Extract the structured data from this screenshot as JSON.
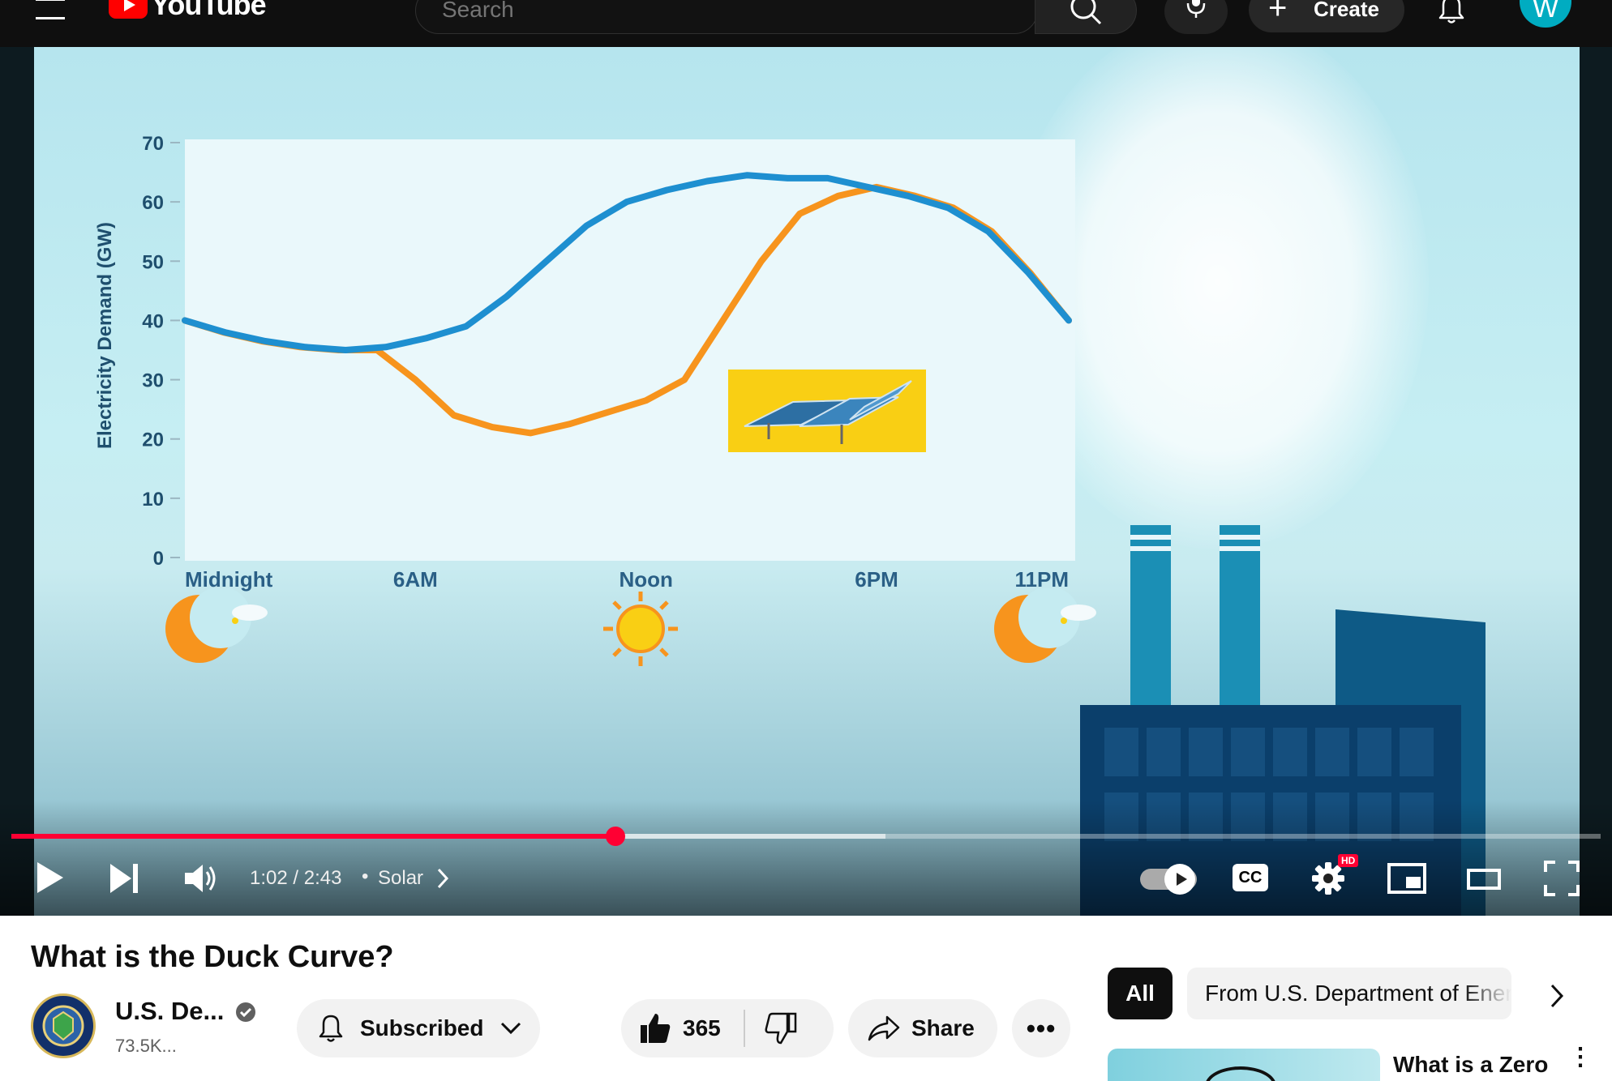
{
  "header": {
    "logo_text": "YouTube",
    "search_placeholder": "Search",
    "create_label": "Create",
    "avatar_letter": "W",
    "brand_color": "#ff0000",
    "avatar_color": "#00acc1"
  },
  "video": {
    "chart_data": {
      "type": "line",
      "ylabel": "Electricity Demand (GW)",
      "yticks": [
        "70",
        "60",
        "50",
        "40",
        "30",
        "20",
        "10",
        "0"
      ],
      "ylim": [
        0,
        70
      ],
      "xticks": [
        "Midnight",
        "6AM",
        "Noon",
        "6PM",
        "11PM"
      ],
      "x": [
        0,
        1,
        2,
        3,
        4,
        5,
        6,
        7,
        8,
        9,
        10,
        11,
        12,
        13,
        14,
        15,
        16,
        17,
        18,
        19,
        20,
        21,
        22,
        23
      ],
      "series": [
        {
          "color": "#1e8fd0",
          "values": [
            40,
            38,
            36.5,
            35.5,
            35,
            35.5,
            37,
            39,
            44,
            50,
            56,
            60,
            62,
            63.5,
            64.5,
            64,
            64,
            62.5,
            61,
            59,
            55,
            48,
            40
          ]
        },
        {
          "color": "#f7941d",
          "values": [
            40,
            38,
            36.5,
            35.5,
            35,
            35,
            30,
            24,
            22,
            21,
            22.5,
            24.5,
            26.5,
            30,
            40,
            50,
            58,
            61,
            62.5,
            61,
            59,
            55,
            48,
            40
          ]
        }
      ]
    },
    "controls": {
      "time": "1:02 / 2:43",
      "chapter": "Solar",
      "progress": 0.38,
      "buffered": 0.55,
      "hd_badge": "HD",
      "cc_label": "CC",
      "progress_color": "#ff0033"
    }
  },
  "title": "What is the Duck Curve?",
  "channel": {
    "name": "U.S. De...",
    "subscribers": "73.5K...",
    "subscribe_label": "Subscribed"
  },
  "actions": {
    "likes": "365",
    "share_label": "Share"
  },
  "sidebar": {
    "chips": [
      "All",
      "From U.S. Department of Ener"
    ],
    "next_video_title": "What is a Zero"
  }
}
